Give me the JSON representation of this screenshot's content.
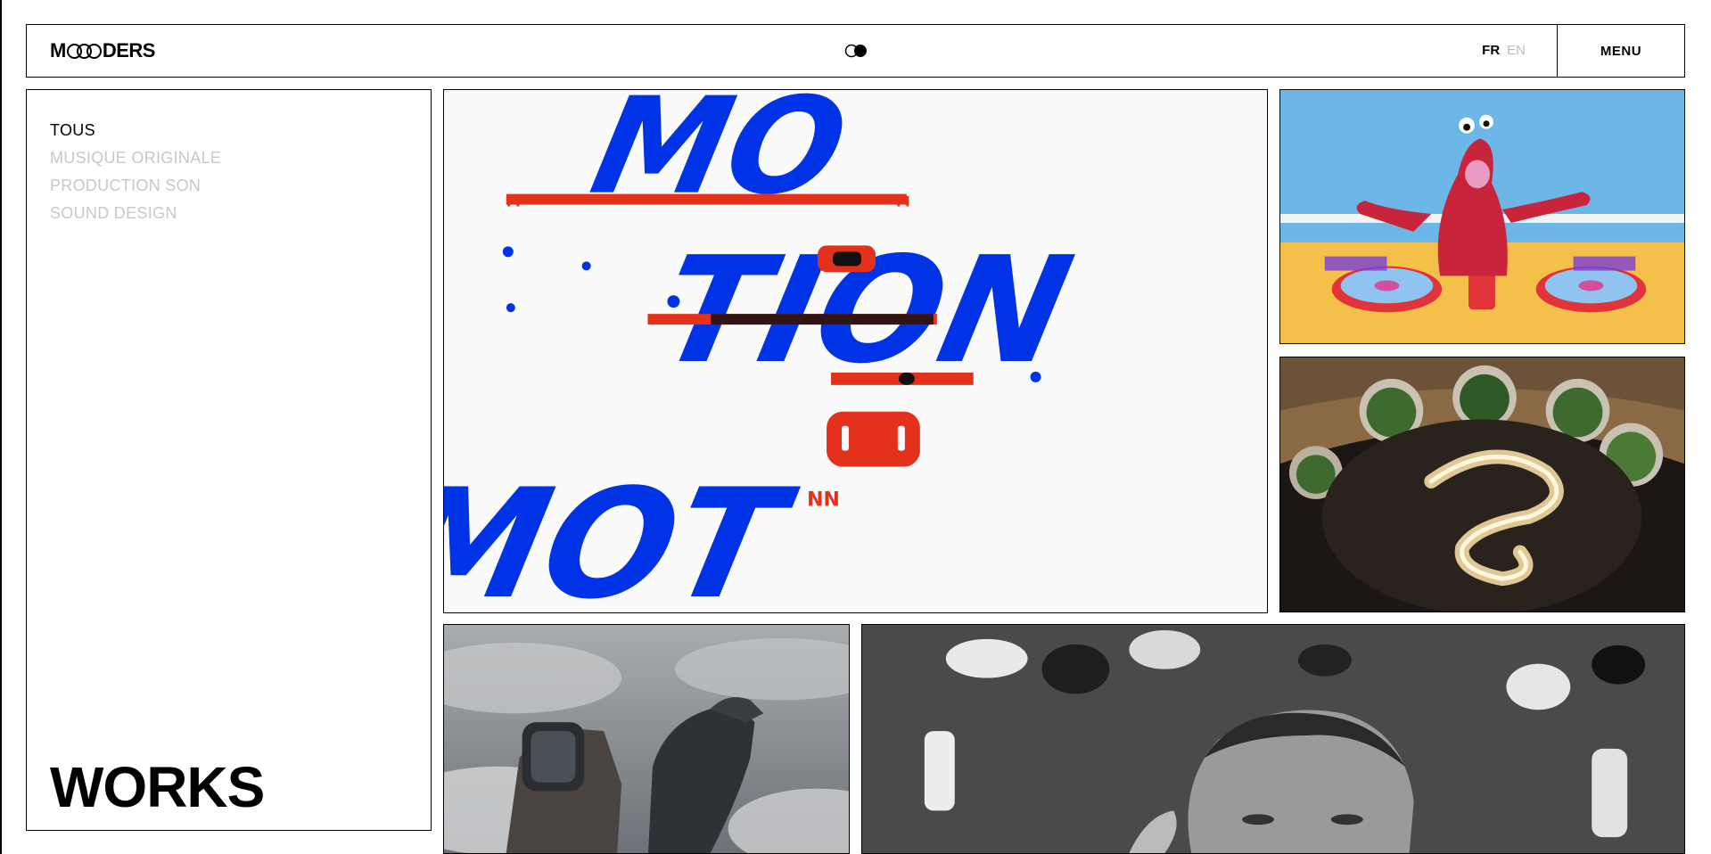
{
  "header": {
    "logo": {
      "prefix": "M",
      "suffix": "DERS"
    },
    "languages": [
      {
        "label": "FR",
        "active": true
      },
      {
        "label": "EN",
        "active": false
      }
    ],
    "menu_label": "MENU"
  },
  "sidebar": {
    "filters": [
      {
        "label": "TOUS",
        "active": true
      },
      {
        "label": "MUSIQUE ORIGINALE",
        "active": false
      },
      {
        "label": "PRODUCTION SON",
        "active": false
      },
      {
        "label": "SOUND DESIGN",
        "active": false
      }
    ],
    "page_title": "WORKS"
  },
  "works": [
    {
      "name": "motion-typography",
      "art_text": [
        "MO",
        "TION",
        "MOT",
        "M",
        "M",
        "NN"
      ]
    },
    {
      "name": "red-puppet-dj"
    },
    {
      "name": "banquet-aerial"
    },
    {
      "name": "watch-eagle"
    },
    {
      "name": "chess-portrait"
    }
  ],
  "colors": {
    "accent_blue": "#0033e6",
    "accent_red": "#e3311b",
    "border": "#000000",
    "muted": "#c8c8c8"
  }
}
